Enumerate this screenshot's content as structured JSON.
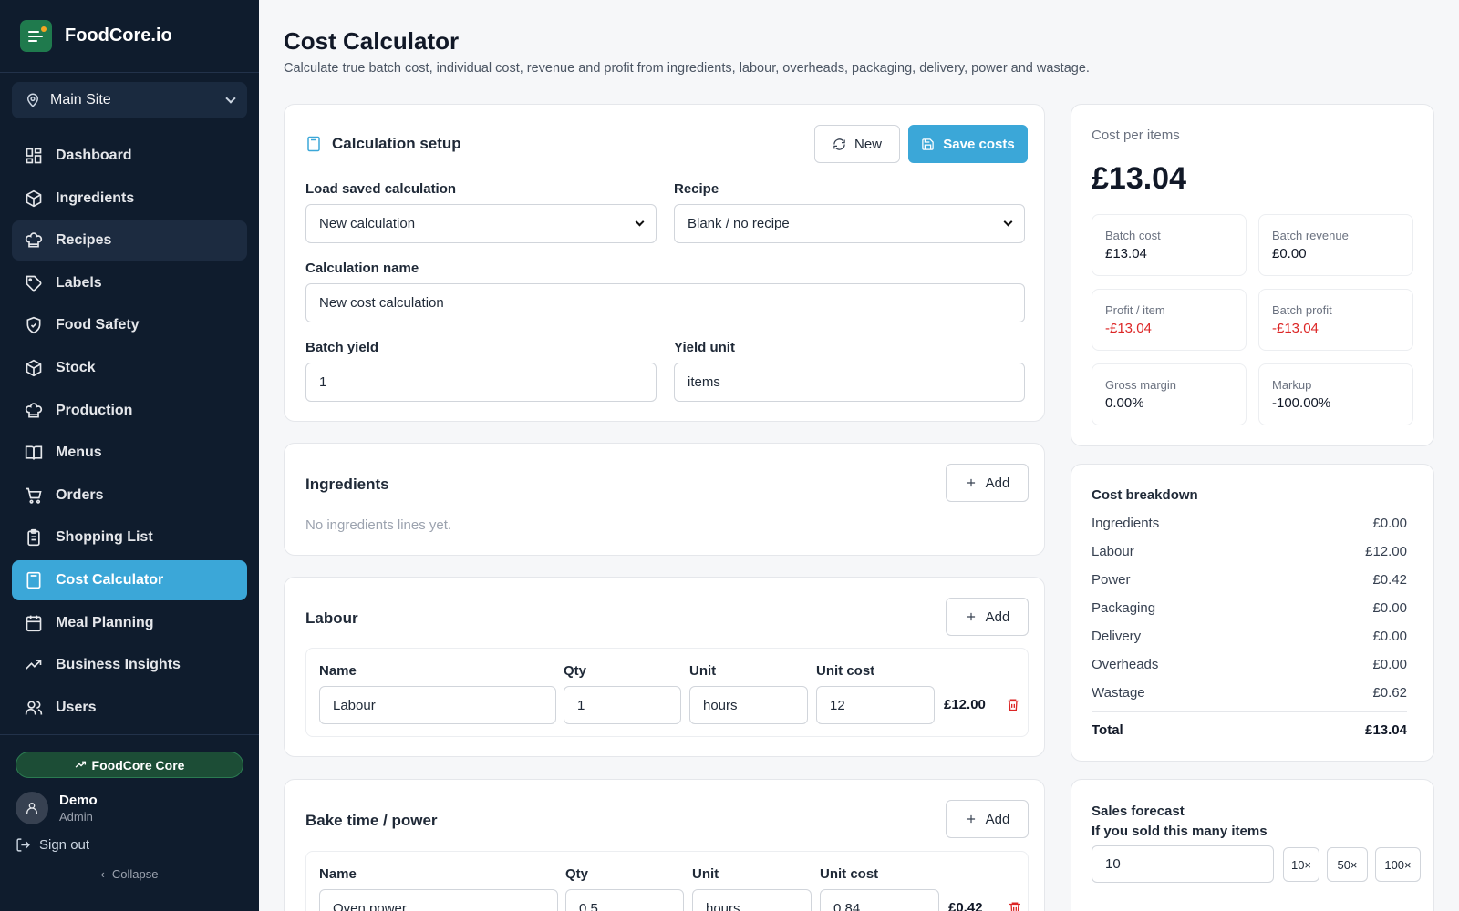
{
  "brand": {
    "name": "FoodCore.io"
  },
  "site_selector": {
    "value": "Main Site",
    "icon": "map-pin-icon"
  },
  "nav": [
    {
      "label": "Dashboard",
      "icon": "dashboard-icon"
    },
    {
      "label": "Ingredients",
      "icon": "box-icon"
    },
    {
      "label": "Recipes",
      "icon": "chef-hat-icon",
      "state": "hover"
    },
    {
      "label": "Labels",
      "icon": "tag-icon"
    },
    {
      "label": "Food Safety",
      "icon": "shield-icon"
    },
    {
      "label": "Stock",
      "icon": "box-icon"
    },
    {
      "label": "Production",
      "icon": "chef-hat-icon"
    },
    {
      "label": "Menus",
      "icon": "book-icon"
    },
    {
      "label": "Orders",
      "icon": "cart-icon"
    },
    {
      "label": "Shopping List",
      "icon": "clipboard-icon"
    },
    {
      "label": "Cost Calculator",
      "icon": "calculator-icon",
      "state": "active"
    },
    {
      "label": "Meal Planning",
      "icon": "calendar-icon"
    },
    {
      "label": "Business Insights",
      "icon": "trend-icon"
    },
    {
      "label": "Users",
      "icon": "users-icon"
    }
  ],
  "plan": {
    "label": "FoodCore Core"
  },
  "user": {
    "name": "Demo",
    "role": "Admin"
  },
  "sidebar_footer": {
    "sign_out": "Sign out",
    "collapse": "Collapse"
  },
  "page": {
    "title": "Cost Calculator",
    "subtitle": "Calculate true batch cost, individual cost, revenue and profit from ingredients, labour, overheads, packaging, delivery, power and wastage."
  },
  "setup": {
    "title": "Calculation setup",
    "new_label": "New",
    "save_label": "Save costs",
    "load_label": "Load saved calculation",
    "load_value": "New calculation",
    "recipe_label": "Recipe",
    "recipe_value": "Blank / no recipe",
    "name_label": "Calculation name",
    "name_value": "New cost calculation",
    "yield_label": "Batch yield",
    "yield_value": "1",
    "unit_label": "Yield unit",
    "unit_value": "items"
  },
  "ingredients": {
    "title": "Ingredients",
    "add_label": "Add",
    "empty": "No ingredients lines yet."
  },
  "labour": {
    "title": "Labour",
    "add_label": "Add",
    "headers": {
      "name": "Name",
      "qty": "Qty",
      "unit": "Unit",
      "unit_cost": "Unit cost"
    },
    "row": {
      "name": "Labour",
      "qty": "1",
      "unit": "hours",
      "unit_cost": "12",
      "total": "£12.00"
    }
  },
  "power": {
    "title": "Bake time / power",
    "add_label": "Add",
    "headers": {
      "name": "Name",
      "qty": "Qty",
      "unit": "Unit",
      "unit_cost": "Unit cost"
    },
    "row": {
      "name": "Oven power",
      "qty": "0.5",
      "unit": "hours",
      "unit_cost": "0.84",
      "total": "£0.42"
    }
  },
  "summary": {
    "label": "Cost per items",
    "value": "£13.04",
    "stats": [
      {
        "label": "Batch cost",
        "value": "£13.04",
        "negative": false
      },
      {
        "label": "Batch revenue",
        "value": "£0.00",
        "negative": false
      },
      {
        "label": "Profit / item",
        "value": "-£13.04",
        "negative": true
      },
      {
        "label": "Batch profit",
        "value": "-£13.04",
        "negative": true
      },
      {
        "label": "Gross margin",
        "value": "0.00%",
        "negative": false
      },
      {
        "label": "Markup",
        "value": "-100.00%",
        "negative": false
      }
    ]
  },
  "breakdown": {
    "title": "Cost breakdown",
    "rows": [
      {
        "label": "Ingredients",
        "value": "£0.00"
      },
      {
        "label": "Labour",
        "value": "£12.00"
      },
      {
        "label": "Power",
        "value": "£0.42"
      },
      {
        "label": "Packaging",
        "value": "£0.00"
      },
      {
        "label": "Delivery",
        "value": "£0.00"
      },
      {
        "label": "Overheads",
        "value": "£0.00"
      },
      {
        "label": "Wastage",
        "value": "£0.62"
      }
    ],
    "total_label": "Total",
    "total_value": "£13.04"
  },
  "forecast": {
    "title": "Sales forecast",
    "subtitle": "If you sold this many items",
    "value": "10",
    "chips": [
      "10×",
      "50×",
      "100×"
    ]
  },
  "colors": {
    "sidebar": "#0f1c2d",
    "accent": "#3ba7d8",
    "negative": "#dc2626",
    "plan": "#1c4d36"
  }
}
